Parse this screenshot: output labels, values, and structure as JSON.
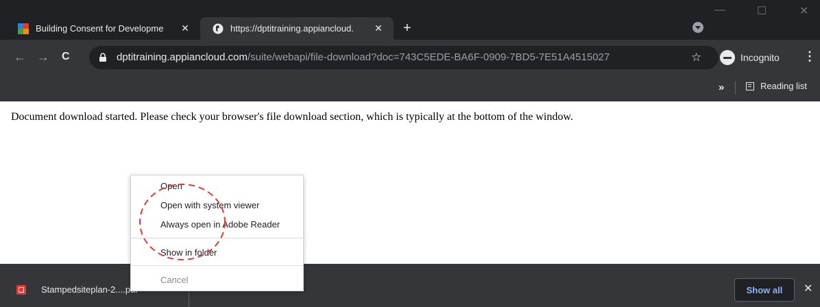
{
  "tabs": [
    {
      "title": "Building Consent for Developme",
      "close": "✕",
      "favicon": "appian-grid-icon",
      "active": false
    },
    {
      "title": "https://dptitraining.appiancloud.",
      "close": "✕",
      "favicon": "globe-icon",
      "active": true
    }
  ],
  "new_tab": "+",
  "window_controls": {
    "minimize": "—",
    "maximize": "☐",
    "close": "✕"
  },
  "nav": {
    "back": "←",
    "forward": "→",
    "reload": "C"
  },
  "address": {
    "host": "dptitraining.appiancloud.com",
    "path": "/suite/webapi/file-download?doc=743C5EDE-BA6F-0909-7BD5-7E51A4515027"
  },
  "star": "☆",
  "profile": {
    "label": "Incognito",
    "icon": "incognito-icon"
  },
  "menu": "⋮",
  "bookmarks": {
    "chevron": "»",
    "reading_list": "Reading list"
  },
  "page": {
    "message": "Document download started. Please check your browser's file download section, which is typically at the bottom of the window."
  },
  "context_menu": {
    "items": [
      "Open",
      "Open with system viewer",
      "Always open in Adobe Reader",
      "Show in folder",
      "Cancel"
    ]
  },
  "download": {
    "filename": "Stampedsiteplan-2....pdf",
    "chevron": "^",
    "icon": "pdf-file-icon"
  },
  "download_bar": {
    "show_all": "Show all",
    "close": "✕"
  },
  "colors": {
    "chrome_dark": "#202124",
    "chrome_toolbar": "#35363a",
    "annotation": "#e53935",
    "link_blue": "#8ab4f8"
  }
}
